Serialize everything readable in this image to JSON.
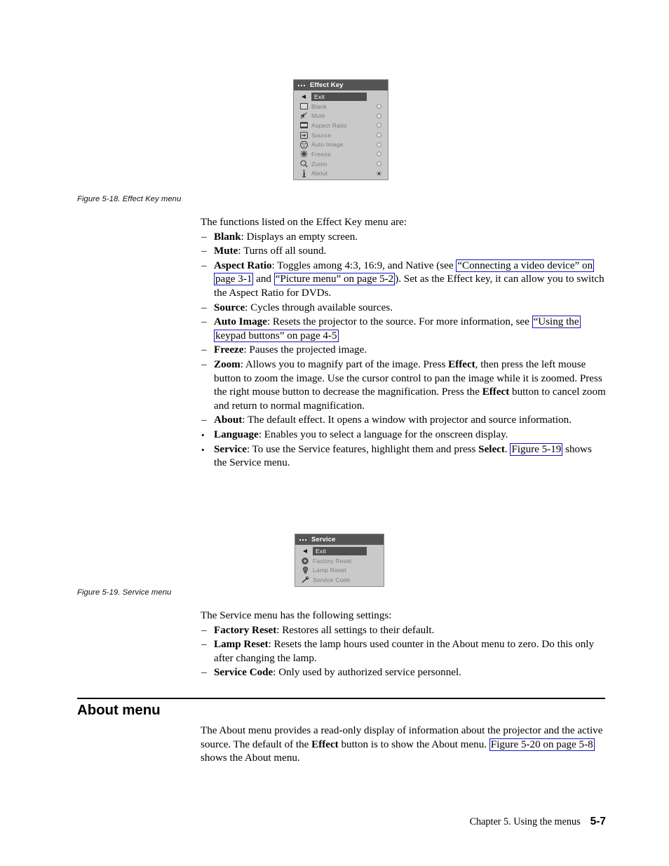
{
  "figures": {
    "effect_key_menu": {
      "title": "Effect Key",
      "caption": "Figure 5-18. Effect Key menu",
      "rows": [
        {
          "icon": "left-triangle-icon",
          "label": "Exit",
          "selected": true,
          "radio": null
        },
        {
          "icon": "blank-screen-icon",
          "label": "Blank",
          "selected": false,
          "radio": "off"
        },
        {
          "icon": "mute-speaker-icon",
          "label": "Mute",
          "selected": false,
          "radio": "off"
        },
        {
          "icon": "aspect-ratio-icon",
          "label": "Aspect Ratio",
          "selected": false,
          "radio": "off"
        },
        {
          "icon": "source-input-icon",
          "label": "Source",
          "selected": false,
          "radio": "off"
        },
        {
          "icon": "auto-image-icon",
          "label": "Auto Image",
          "selected": false,
          "radio": "off"
        },
        {
          "icon": "freeze-snowflake-icon",
          "label": "Freeze",
          "selected": false,
          "radio": "off"
        },
        {
          "icon": "zoom-magnifier-icon",
          "label": "Zoom",
          "selected": false,
          "radio": "off"
        },
        {
          "icon": "about-info-icon",
          "label": "About",
          "selected": false,
          "radio": "on"
        }
      ]
    },
    "service_menu": {
      "title": "Service",
      "caption": "Figure 5-19. Service menu",
      "rows": [
        {
          "icon": "left-triangle-icon",
          "label": "Exit",
          "selected": true
        },
        {
          "icon": "factory-reset-icon",
          "label": "Factory Reset",
          "selected": false
        },
        {
          "icon": "lamp-reset-icon",
          "label": "Lamp Reset",
          "selected": false
        },
        {
          "icon": "service-code-wrench-icon",
          "label": "Service Code",
          "selected": false
        }
      ]
    }
  },
  "effect_section": {
    "intro": "The functions listed on the Effect Key menu are:",
    "items": {
      "blank": {
        "term": "Blank",
        "text": ": Displays an empty screen."
      },
      "mute": {
        "term": "Mute",
        "text": ": Turns off all sound."
      },
      "aspect_ratio": {
        "term": "Aspect Ratio",
        "text_1": ": Toggles among 4:3, 16:9, and Native (see ",
        "link_1": "“Connecting a video device” on page 3-1",
        "text_2": " and ",
        "link_2": "“Picture menu” on page 5-2",
        "text_3": "). Set as the Effect key, it can allow you to switch the Aspect Ratio for DVDs."
      },
      "source": {
        "term": "Source",
        "text": ": Cycles through available sources."
      },
      "auto_image": {
        "term": "Auto Image",
        "text_1": ": Resets the projector to the source. For more information, see ",
        "link_1": "“Using the keypad buttons” on page 4-5"
      },
      "freeze": {
        "term": "Freeze",
        "text": ": Pauses the projected image."
      },
      "zoom": {
        "term": "Zoom",
        "text_1": ": Allows you to magnify part of the image. Press ",
        "bold_1": "Effect",
        "text_2": ", then press the left mouse button to zoom the image. Use the cursor control to pan the image while it is zoomed. Press the right mouse button to decrease the magnification. Press the ",
        "bold_2": "Effect",
        "text_3": " button to cancel zoom and return to normal magnification."
      },
      "about": {
        "term": "About",
        "text": ": The default effect. It opens a window with projector and source information."
      },
      "language": {
        "term": "Language",
        "text": ": Enables you to select a language for the onscreen display."
      },
      "service": {
        "term": "Service",
        "text_1": ": To use the Service features, highlight them and press ",
        "bold_1": "Select",
        "text_2": ". ",
        "link_1": "Figure 5-19",
        "text_3": " shows the Service menu."
      }
    }
  },
  "service_section": {
    "intro": "The Service menu has the following settings:",
    "items": {
      "factory_reset": {
        "term": "Factory Reset",
        "text": ": Restores all settings to their default."
      },
      "lamp_reset": {
        "term": "Lamp Reset",
        "text": ": Resets the lamp hours used counter in the About menu to zero. Do this only after changing the lamp."
      },
      "service_code": {
        "term": "Service Code",
        "text": ": Only used by authorized service personnel."
      }
    }
  },
  "about_section": {
    "heading": "About menu",
    "text_1": "The About menu provides a read-only display of information about the projector and the active source. The default of the ",
    "bold_1": "Effect",
    "text_2": " button is to show the About menu. ",
    "link_1": "Figure 5-20 on page 5-8",
    "text_3": " shows the About menu."
  },
  "footer": {
    "chapter": "Chapter 5. Using the menus",
    "page": "5-7"
  },
  "colors": {
    "link_box": "#1414c8",
    "osd_header_bg": "#555555",
    "osd_body_bg": "#c9c9c9",
    "osd_selected_bg": "#4e4e4e"
  }
}
